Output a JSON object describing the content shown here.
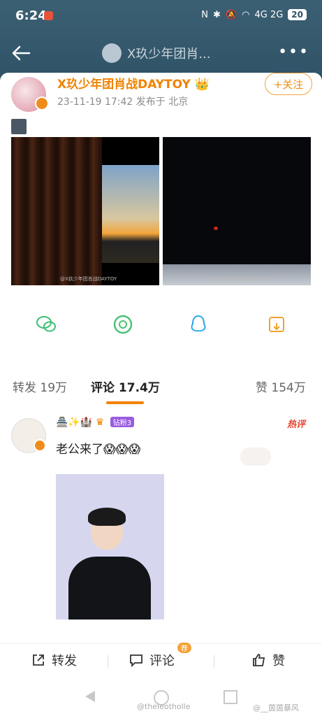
{
  "status": {
    "time": "6:24",
    "battery": "20",
    "network": "4G 2G"
  },
  "nav": {
    "title": "X玖少年团肖..."
  },
  "post": {
    "username": "X玖少年团肖战DAYTOY",
    "timestamp": "23-11-19 17:42",
    "location": "发布于 北京",
    "follow_label": "+关注",
    "watermark": "@X玖少年团肖战DAYTOY"
  },
  "tabs": {
    "repost_label": "转发",
    "repost_count": "19万",
    "comment_label": "评论",
    "comment_count": "17.4万",
    "like_label": "赞",
    "like_count": "154万"
  },
  "comment": {
    "fan_badge": "钻粉3",
    "hot_tag": "热评",
    "text": "老公来了😱😱😱"
  },
  "bottom": {
    "repost": "转发",
    "comment": "评论",
    "recommend": "荐",
    "like": "赞"
  },
  "footer": {
    "wm_left": "@theleotholle",
    "wm_right": "@__茵茵暴风"
  },
  "colors": {
    "accent": "#f08300",
    "header": "#2f5266"
  }
}
